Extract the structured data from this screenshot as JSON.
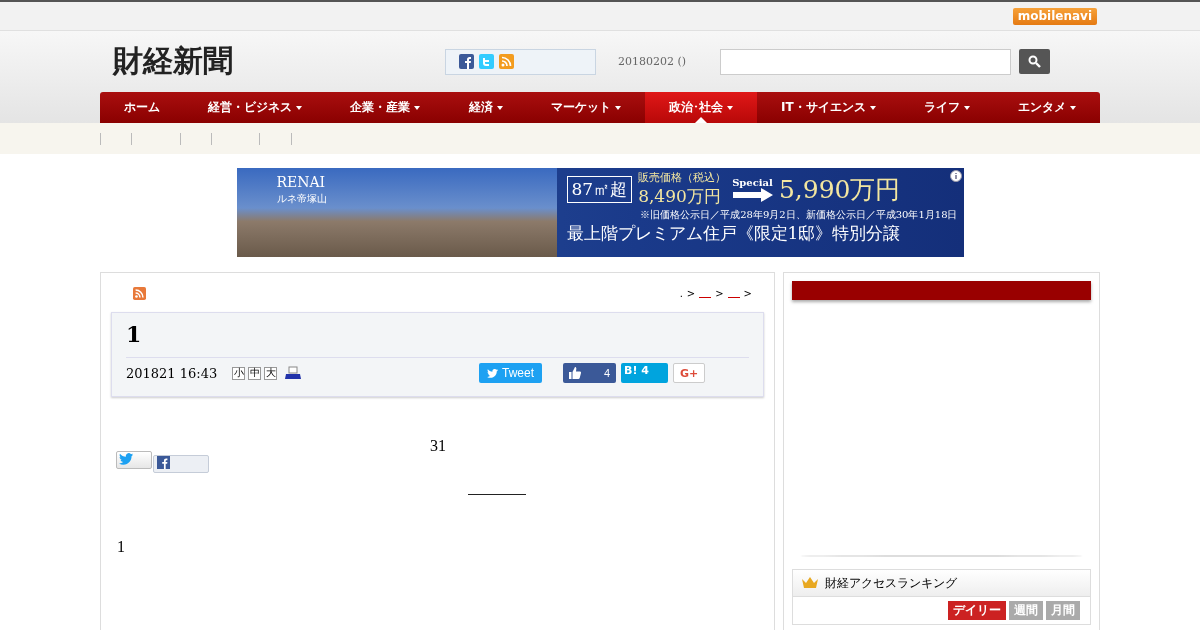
{
  "topbar": {
    "logo": "mobilenavi"
  },
  "header": {
    "site_title": "財経新聞",
    "date": "20180202 ()"
  },
  "nav": [
    {
      "label": "ホーム",
      "has_menu": false,
      "selected": false
    },
    {
      "label": "経営・ビジネス",
      "has_menu": true,
      "selected": false
    },
    {
      "label": "企業・産業",
      "has_menu": true,
      "selected": false
    },
    {
      "label": "経済",
      "has_menu": true,
      "selected": false
    },
    {
      "label": "マーケット",
      "has_menu": true,
      "selected": false
    },
    {
      "label": "政治･社会",
      "has_menu": true,
      "selected": true
    },
    {
      "label": "IT・サイエンス",
      "has_menu": true,
      "selected": false
    },
    {
      "label": "ライフ",
      "has_menu": true,
      "selected": false
    },
    {
      "label": "エンタメ",
      "has_menu": true,
      "selected": false
    }
  ],
  "ad": {
    "brand": "RENAI",
    "brand_sub": "ルネ帝塚山",
    "area": "87㎡超",
    "price_label": "販売価格（税込）",
    "old_price": "8,490万円",
    "special": "Special",
    "new_price": "5,990万円",
    "note": "※旧価格公示日／平成28年9月2日、新価格公示日／平成30年1月18日",
    "headline": "最上階プレミアム住戸《限定1邸》特別分譲"
  },
  "article": {
    "breadcrumb": [
      ".",
      ">",
      ">",
      ">"
    ],
    "title": "1",
    "date": "201821 16:43",
    "font_sizes": [
      "小",
      "中",
      "大"
    ],
    "share": {
      "tweet": "Tweet",
      "like_count": "4",
      "hatena": "B!",
      "hatena_count": "4",
      "gplus": "G+"
    },
    "body": [
      {
        "kind": "center",
        "text": "31"
      },
      {
        "kind": "rule"
      },
      {
        "kind": "left",
        "text": "1"
      }
    ]
  },
  "sidebar": {
    "ranking": {
      "title": "財経アクセスランキング",
      "tabs": [
        {
          "label": "デイリー",
          "selected": true
        },
        {
          "label": "週間",
          "selected": false
        },
        {
          "label": "月間",
          "selected": false
        }
      ]
    }
  }
}
